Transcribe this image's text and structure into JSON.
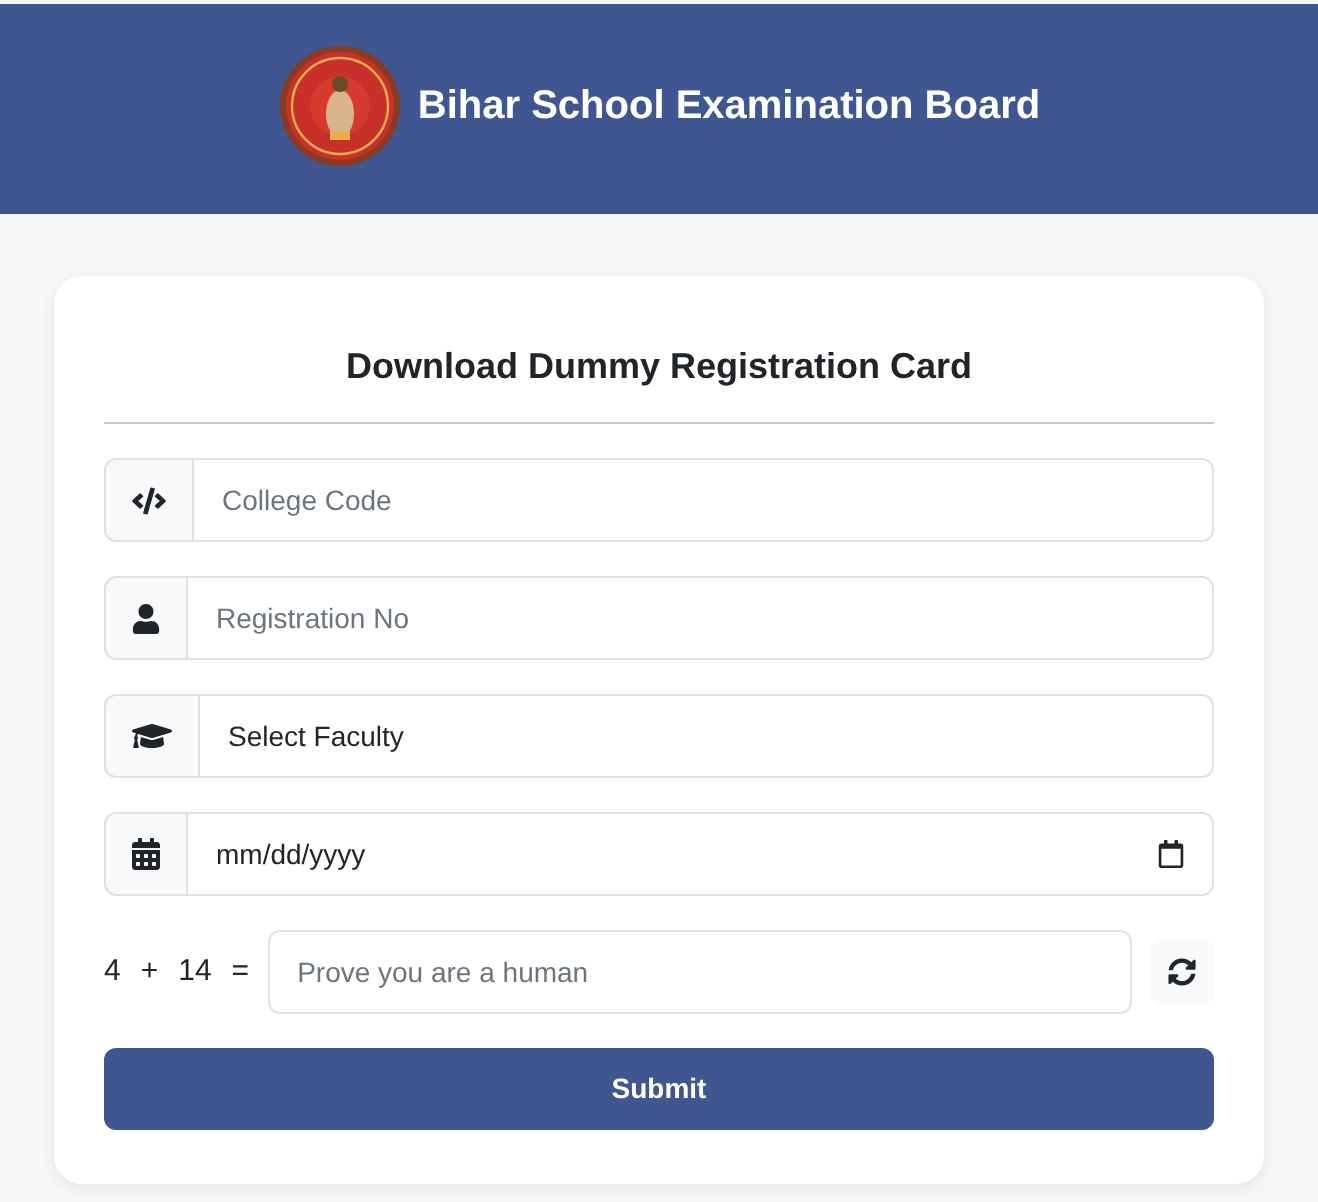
{
  "header": {
    "title": "Bihar School Examination Board"
  },
  "card": {
    "title": "Download Dummy Registration Card",
    "fields": [
      {
        "kind": "text",
        "placeholder": "College Code"
      },
      {
        "kind": "text",
        "placeholder": "Registration No"
      },
      {
        "kind": "select",
        "value": "Select Faculty"
      },
      {
        "kind": "date",
        "placeholder": "mm/dd/yyyy"
      }
    ],
    "captcha": {
      "parts": [
        "4",
        "+",
        "14",
        "="
      ],
      "placeholder": "Prove you are a human"
    },
    "submit": "Submit"
  }
}
